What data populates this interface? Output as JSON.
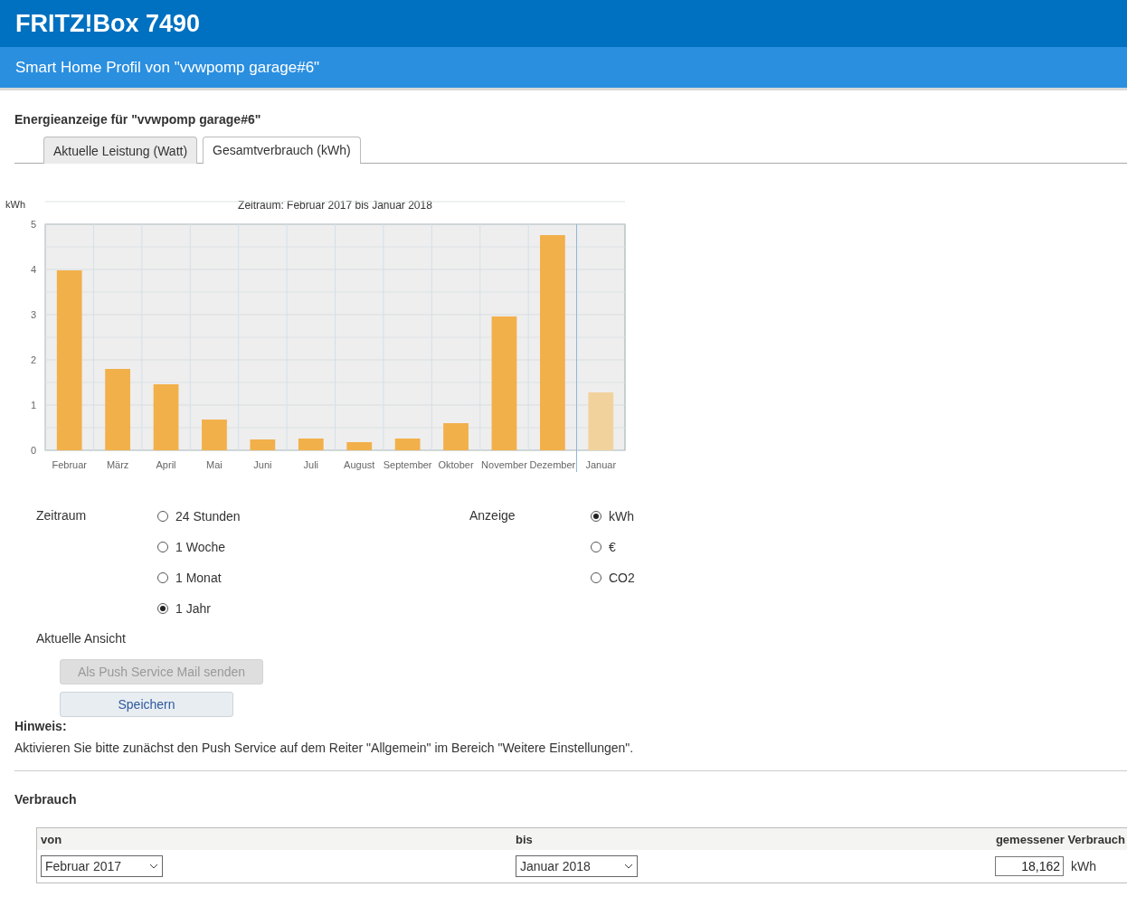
{
  "header": {
    "title": "FRITZ!Box 7490",
    "subtitle": "Smart Home Profil von \"vvwpomp garage#6\""
  },
  "section_title": "Energieanzeige für \"vvwpomp garage#6\"",
  "tabs": [
    {
      "label": "Aktuelle Leistung (Watt)",
      "selected": false
    },
    {
      "label": "Gesamtverbrauch (kWh)",
      "selected": true
    }
  ],
  "chart": {
    "chart_data": {
      "type": "bar",
      "title": "Zeitraum: Februar 2017 bis Januar 2018",
      "ylabel": "kWh",
      "categories": [
        "Februar",
        "März",
        "April",
        "Mai",
        "Juni",
        "Juli",
        "August",
        "September",
        "Oktober",
        "November",
        "Dezember",
        "Januar"
      ],
      "stacked": true,
      "grid": true,
      "ylim": [
        0,
        5
      ],
      "yticks": [
        0,
        1,
        2,
        3,
        4,
        5
      ],
      "series": [
        {
          "color": "#f2b04a",
          "values": [
            3.98,
            1.8,
            1.46,
            0.68,
            0.24,
            0.26,
            0.18,
            0.26,
            0.6,
            2.96,
            4.76,
            null
          ]
        },
        {
          "color": "#f2d29c",
          "values": [
            null,
            null,
            null,
            null,
            null,
            null,
            null,
            null,
            null,
            null,
            null,
            1.28
          ]
        }
      ]
    }
  },
  "zeitraum": {
    "label": "Zeitraum",
    "options": [
      {
        "label": "24 Stunden",
        "selected": false
      },
      {
        "label": "1 Woche",
        "selected": false
      },
      {
        "label": "1 Monat",
        "selected": false
      },
      {
        "label": "1 Jahr",
        "selected": true
      }
    ]
  },
  "anzeige": {
    "label": "Anzeige",
    "options": [
      {
        "label": "kWh",
        "selected": true
      },
      {
        "label": "€",
        "selected": false
      },
      {
        "label": "CO2",
        "selected": false
      }
    ]
  },
  "current_view": {
    "label": "Aktuelle Ansicht",
    "buttons": [
      {
        "label": "Als Push Service Mail senden",
        "disabled": true
      },
      {
        "label": "Speichern",
        "disabled": false
      }
    ]
  },
  "note": {
    "title": "Hinweis:",
    "text": "Aktivieren Sie bitte zunächst den Push Service auf dem Reiter \"Allgemein\" im Bereich \"Weitere Einstellungen\"."
  },
  "consumption": {
    "title": "Verbrauch",
    "columns": [
      "von",
      "bis",
      "gemessener Verbrauch"
    ],
    "from": "Februar 2017",
    "to": "Januar 2018",
    "value": "18,162",
    "unit": "kWh"
  }
}
